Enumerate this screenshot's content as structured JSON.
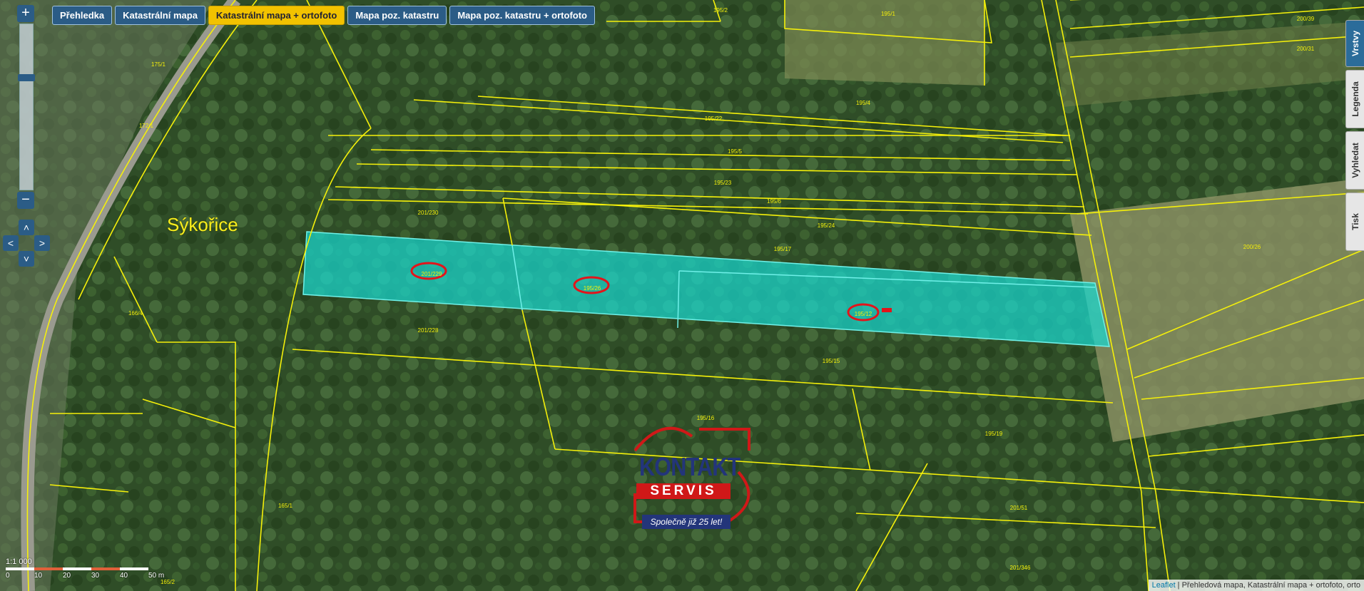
{
  "layers": [
    {
      "label": "Přehledka",
      "active": false
    },
    {
      "label": "Katastrální mapa",
      "active": false
    },
    {
      "label": "Katastrální mapa + ortofoto",
      "active": true
    },
    {
      "label": "Mapa poz. katastru",
      "active": false
    },
    {
      "label": "Mapa poz. katastru + ortofoto",
      "active": false
    }
  ],
  "zoom": {
    "in_label": "+",
    "out_label": "−"
  },
  "pan": {
    "up": "˄",
    "down": "˅",
    "left": "˂",
    "right": "˃"
  },
  "side_tabs": [
    {
      "label": "Vrstvy",
      "active": true
    },
    {
      "label": "Legenda",
      "active": false
    },
    {
      "label": "Vyhledat",
      "active": false
    },
    {
      "label": "Tisk",
      "active": false
    }
  ],
  "village_label": "Sýkořice",
  "parcel_labels": [
    "195/2",
    "195/1",
    "195/4",
    "195/22",
    "195/5",
    "195/23",
    "195/6",
    "195/24",
    "195/17",
    "201/230",
    "201/229",
    "195/26",
    "195/12",
    "201/228",
    "195/15",
    "195/16",
    "195/19",
    "201/51",
    "201/346",
    "165/1",
    "165/2",
    "166/4",
    "200/26",
    "200/31",
    "200/39",
    "175/1",
    "172/1"
  ],
  "highlighted_parcels": [
    "201/229",
    "195/26",
    "195/12"
  ],
  "scale": {
    "ratio": "1:1 000",
    "ticks": [
      "0",
      "10",
      "20",
      "30",
      "40",
      "50 m"
    ]
  },
  "logo": {
    "name": "KONTAKT",
    "subname": "SERVIS",
    "slogan": "Společně již 25 let!"
  },
  "attribution": {
    "link": "Leaflet",
    "text": " | Přehledová mapa, Katastrální mapa + ortofoto, orto"
  },
  "colors": {
    "parcel_line": "#f5f00a",
    "highlight_fill": "#19d8d0",
    "circle": "#e3141b",
    "button": "#2b5c86",
    "button_active": "#f2c200"
  }
}
